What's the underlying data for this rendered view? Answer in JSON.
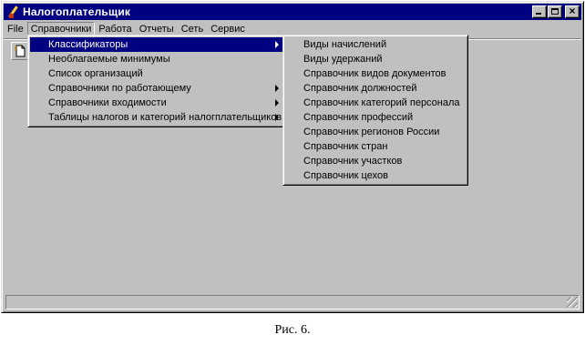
{
  "window": {
    "title": "Налогоплательщик"
  },
  "menubar": [
    "File",
    "Справочники",
    "Работа",
    "Отчеты",
    "Сеть",
    "Сервис"
  ],
  "submenu": [
    {
      "label": "Классификаторы",
      "has_arrow": true,
      "highlighted": true
    },
    {
      "label": "Необлагаемые минимумы",
      "has_arrow": false
    },
    {
      "label": "Список организаций",
      "has_arrow": false
    },
    {
      "label": "Справочники по работающему",
      "has_arrow": true
    },
    {
      "label": "Справочники входимости",
      "has_arrow": true
    },
    {
      "label": "Таблицы налогов и категорий налогплательщиков",
      "has_arrow": true
    }
  ],
  "classifiers": [
    "Виды начислений",
    "Виды удержаний",
    "Справочник видов документов",
    "Справочник должностей",
    "Справочник категорий персонала",
    "Справочник профессий",
    "Справочник регионов России",
    "Справочник стран",
    "Справочник участков",
    "Справочник цехов"
  ],
  "caption": "Рис. 6."
}
